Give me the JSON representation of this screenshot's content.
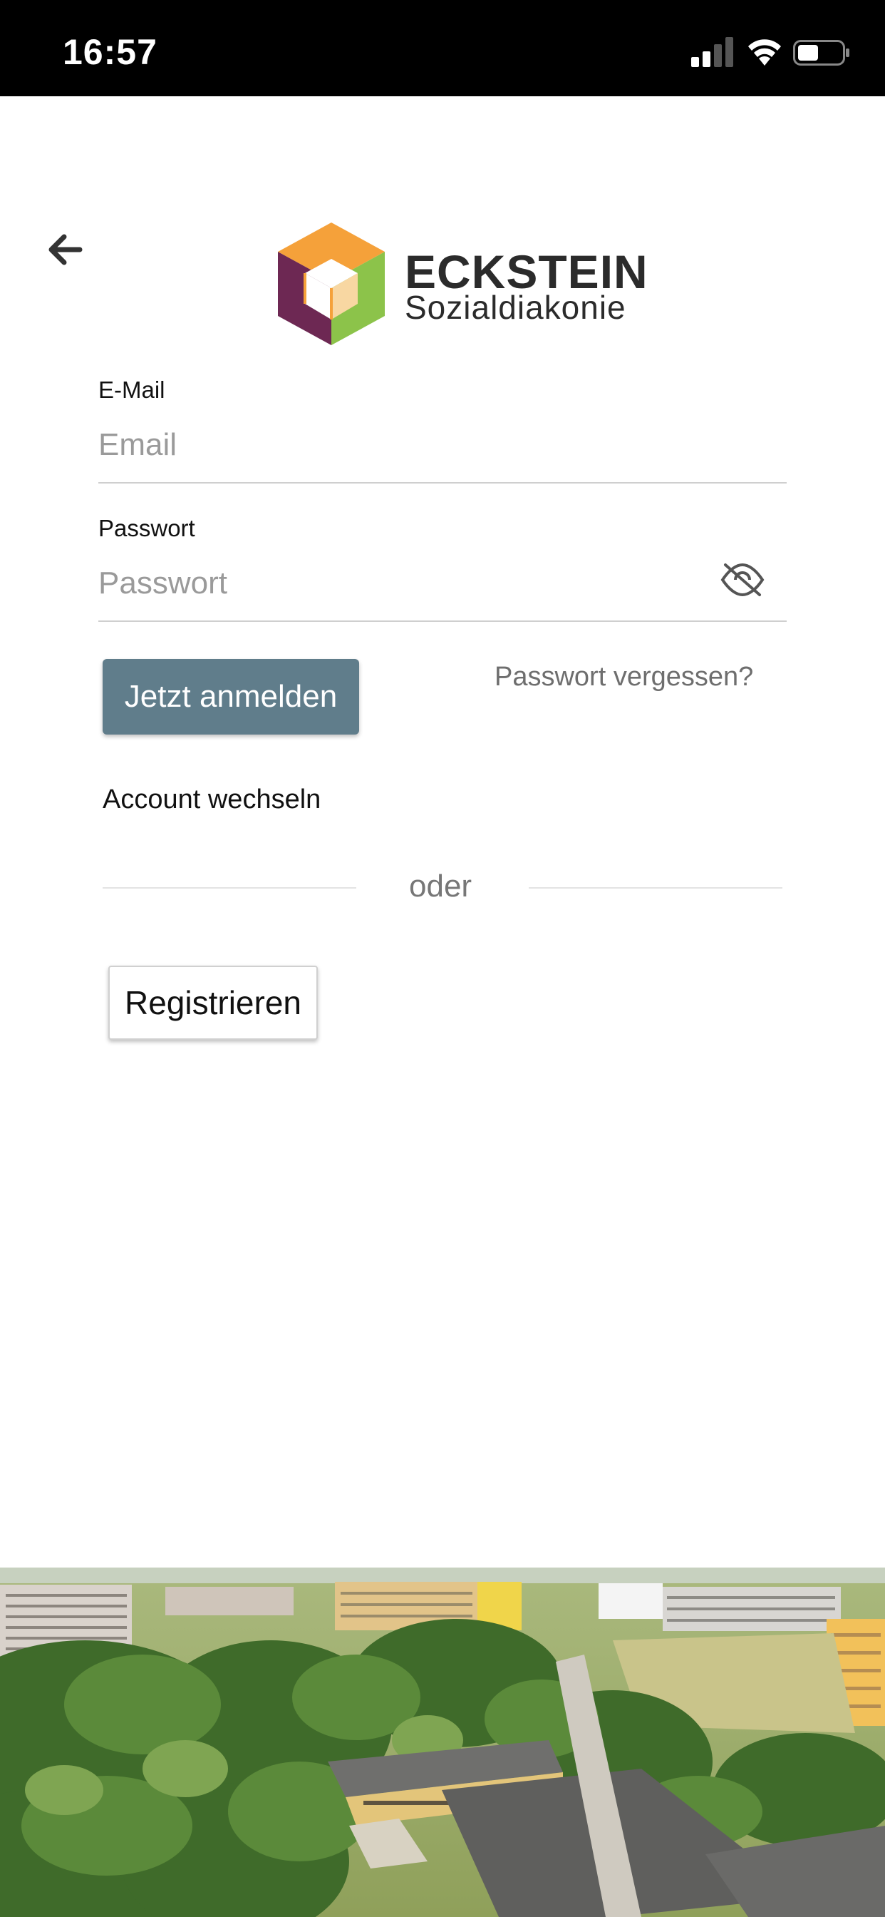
{
  "status_bar": {
    "time": "16:57"
  },
  "logo": {
    "title": "ECKSTEIN",
    "subtitle": "Sozialdiakonie",
    "colors": {
      "orange": "#f5a13a",
      "green": "#8cc34a",
      "purple": "#6d2853"
    }
  },
  "form": {
    "email_label": "E-Mail",
    "email_placeholder": "Email",
    "password_label": "Passwort",
    "password_placeholder": "Passwort",
    "login_button": "Jetzt anmelden",
    "forgot_password": "Passwort vergessen?",
    "switch_account": "Account wechseln",
    "divider_text": "oder",
    "register_button": "Registrieren"
  },
  "colors": {
    "primary_button": "#607d8b"
  },
  "icons": {
    "back": "arrow-left-icon",
    "toggle_password": "eye-off-icon"
  }
}
